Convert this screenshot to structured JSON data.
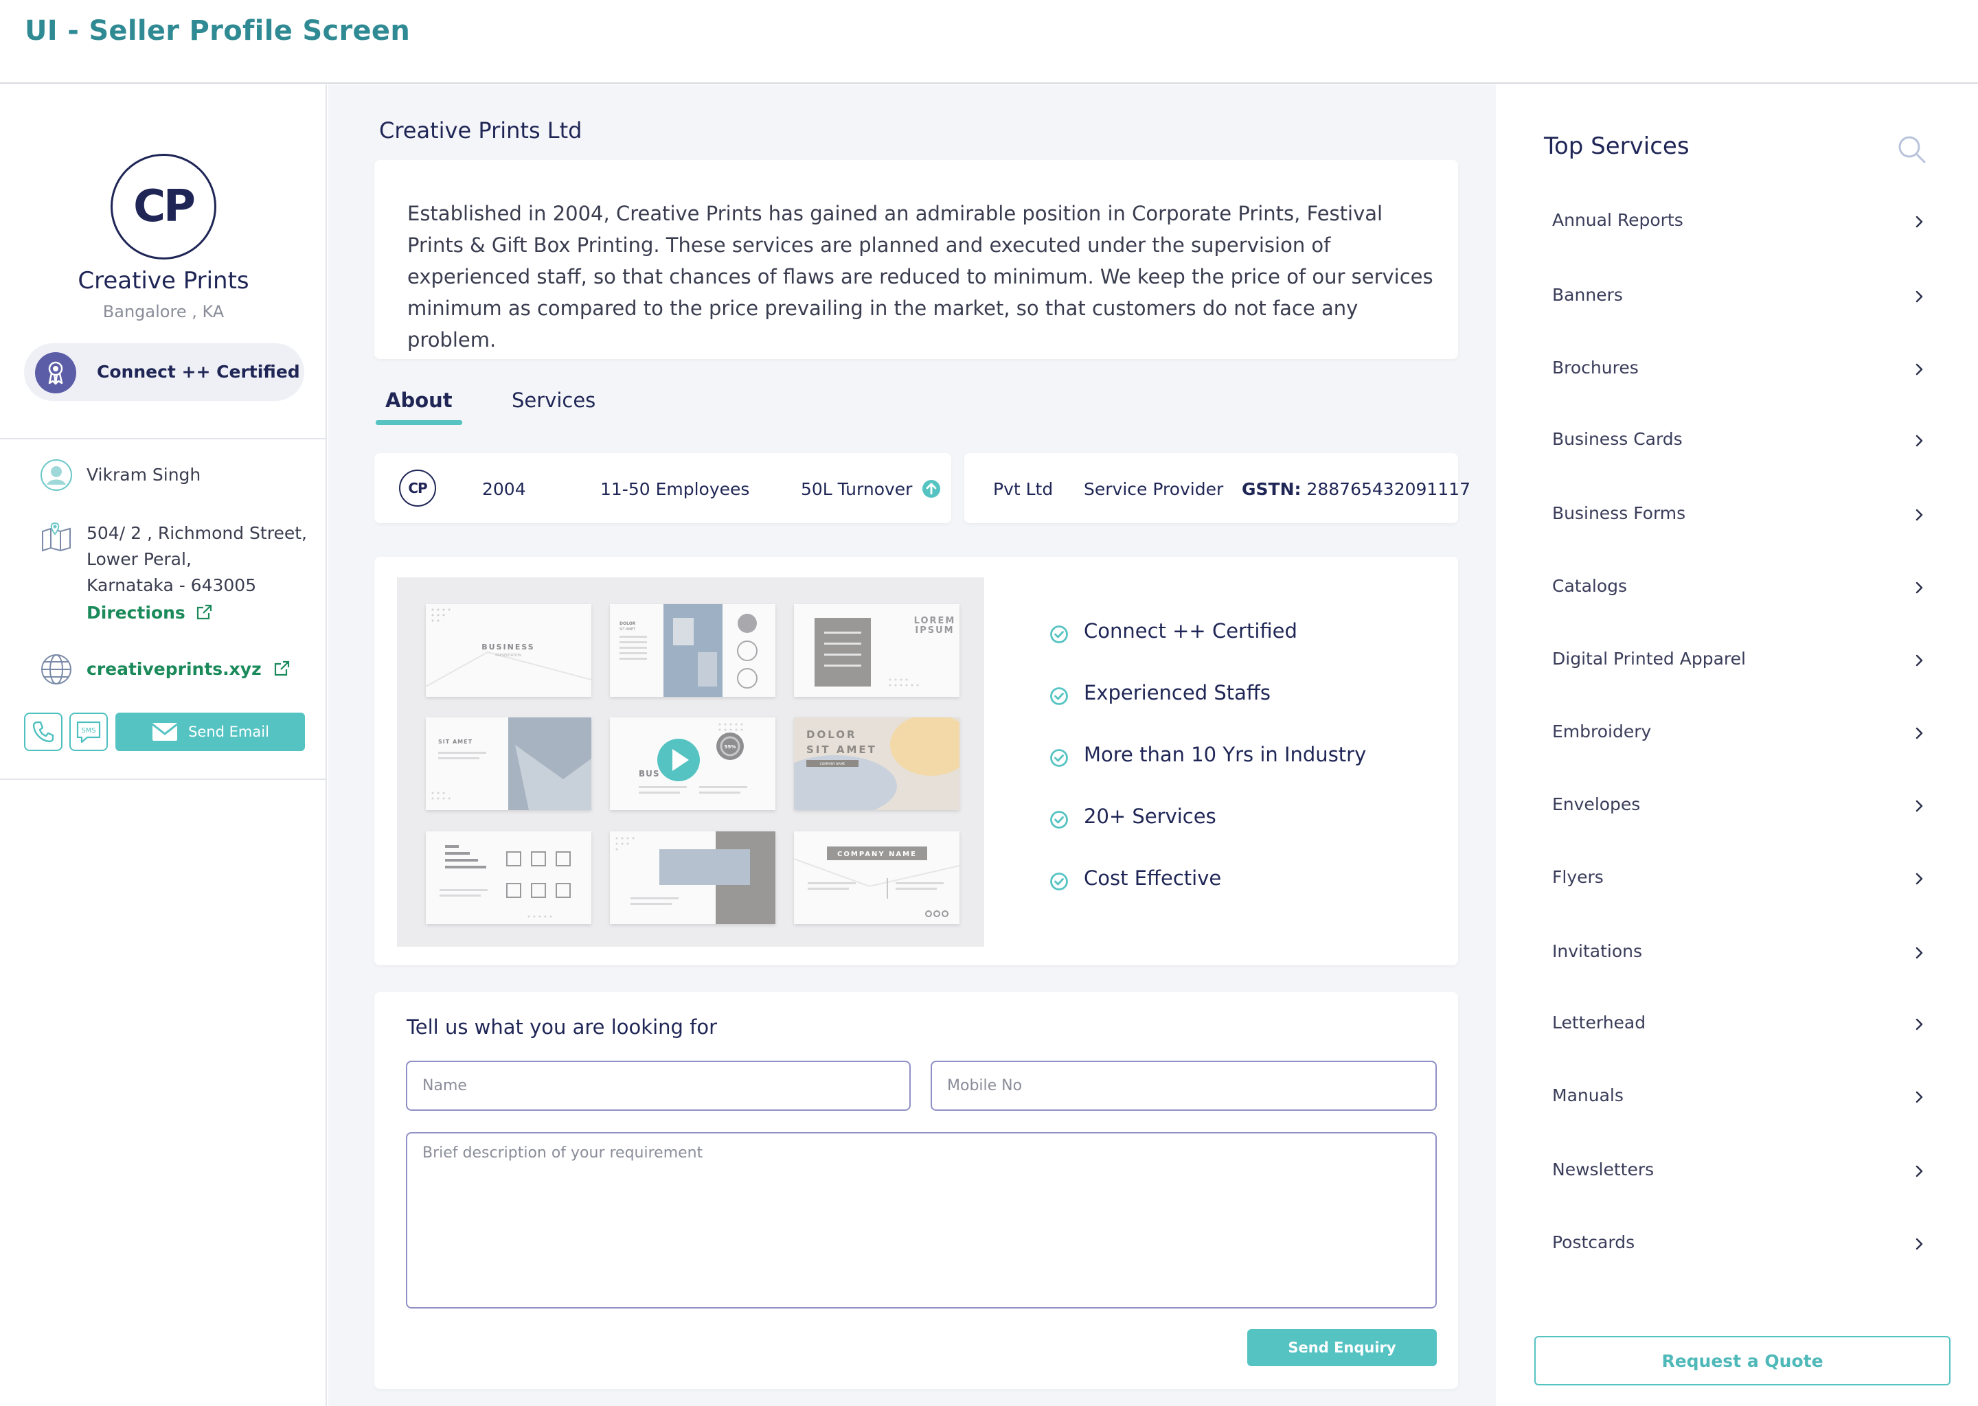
{
  "page_title": "UI - Seller Profile Screen",
  "seller": {
    "logo_text": "CP",
    "name": "Creative Prints",
    "location": "Bangalore , KA",
    "certification": "Connect ++ Certified",
    "contact_name": "Vikram Singh",
    "address_line1": "504/ 2 , Richmond Street,",
    "address_line2": "Lower Peral,",
    "address_line3": "Karnataka - 643005",
    "directions_label": "Directions",
    "website": "creativeprints.xyz",
    "sms_label": "SMS",
    "send_email_label": "Send Email"
  },
  "company": {
    "title": "Creative Prints Ltd",
    "description": "Established in 2004, Creative Prints has gained an admirable position in Corporate Prints, Festival Prints & Gift Box Printing. These services are planned and executed under the supervision of experienced staff, so that chances of flaws are reduced to minimum. We keep the price of our services minimum as compared to the price prevailing in the market, so that customers do not face any problem."
  },
  "tabs": [
    {
      "label": "About",
      "active": true
    },
    {
      "label": "Services",
      "active": false
    }
  ],
  "facts": {
    "logo_text": "CP",
    "year": "2004",
    "employees": "11-50 Employees",
    "turnover": "50L Turnover",
    "entity": "Pvt Ltd",
    "role": "Service Provider",
    "gstn_label": "GSTN:",
    "gstn_value": " 288765432091117"
  },
  "gallery": {
    "t1": {
      "title": "BUSINESS",
      "sub": "PRESENTATION"
    },
    "t2": {
      "title": "DOLOR",
      "sub": "SIT AMET"
    },
    "t3": {
      "title": "LOREM",
      "sub": "IPSUM"
    },
    "t4": {
      "title": "SIT AMET"
    },
    "t5": {
      "title": "BUS",
      "badge": "55%"
    },
    "t6": {
      "title": "DOLOR",
      "sub": "SIT AMET",
      "tag": "COMPANY NAME"
    },
    "t9": {
      "title": "COMPANY NAME"
    }
  },
  "features": [
    "Connect ++ Certified",
    "Experienced Staffs",
    "More than 10 Yrs in Industry",
    "20+ Services",
    "Cost Effective"
  ],
  "enquiry": {
    "title": "Tell us what you are looking for",
    "name_placeholder": "Name",
    "mobile_placeholder": "Mobile No",
    "description_placeholder": "Brief description of your requirement",
    "submit_label": "Send Enquiry"
  },
  "top_services": {
    "title": "Top Services",
    "items": [
      "Annual Reports",
      "Banners",
      "Brochures",
      "Business Cards",
      "Business Forms",
      "Catalogs",
      "Digital Printed Apparel",
      "Embroidery",
      "Envelopes",
      "Flyers",
      "Invitations",
      "Letterhead",
      "Manuals",
      "Newsletters",
      "Postcards"
    ],
    "quote_label": "Request a Quote"
  },
  "colors": {
    "brand_teal": "#56c3c3",
    "title_teal": "#2f8a93",
    "navy": "#1f2656",
    "link_green": "#1b8a5a",
    "badge_purple": "#5b5ea6"
  }
}
